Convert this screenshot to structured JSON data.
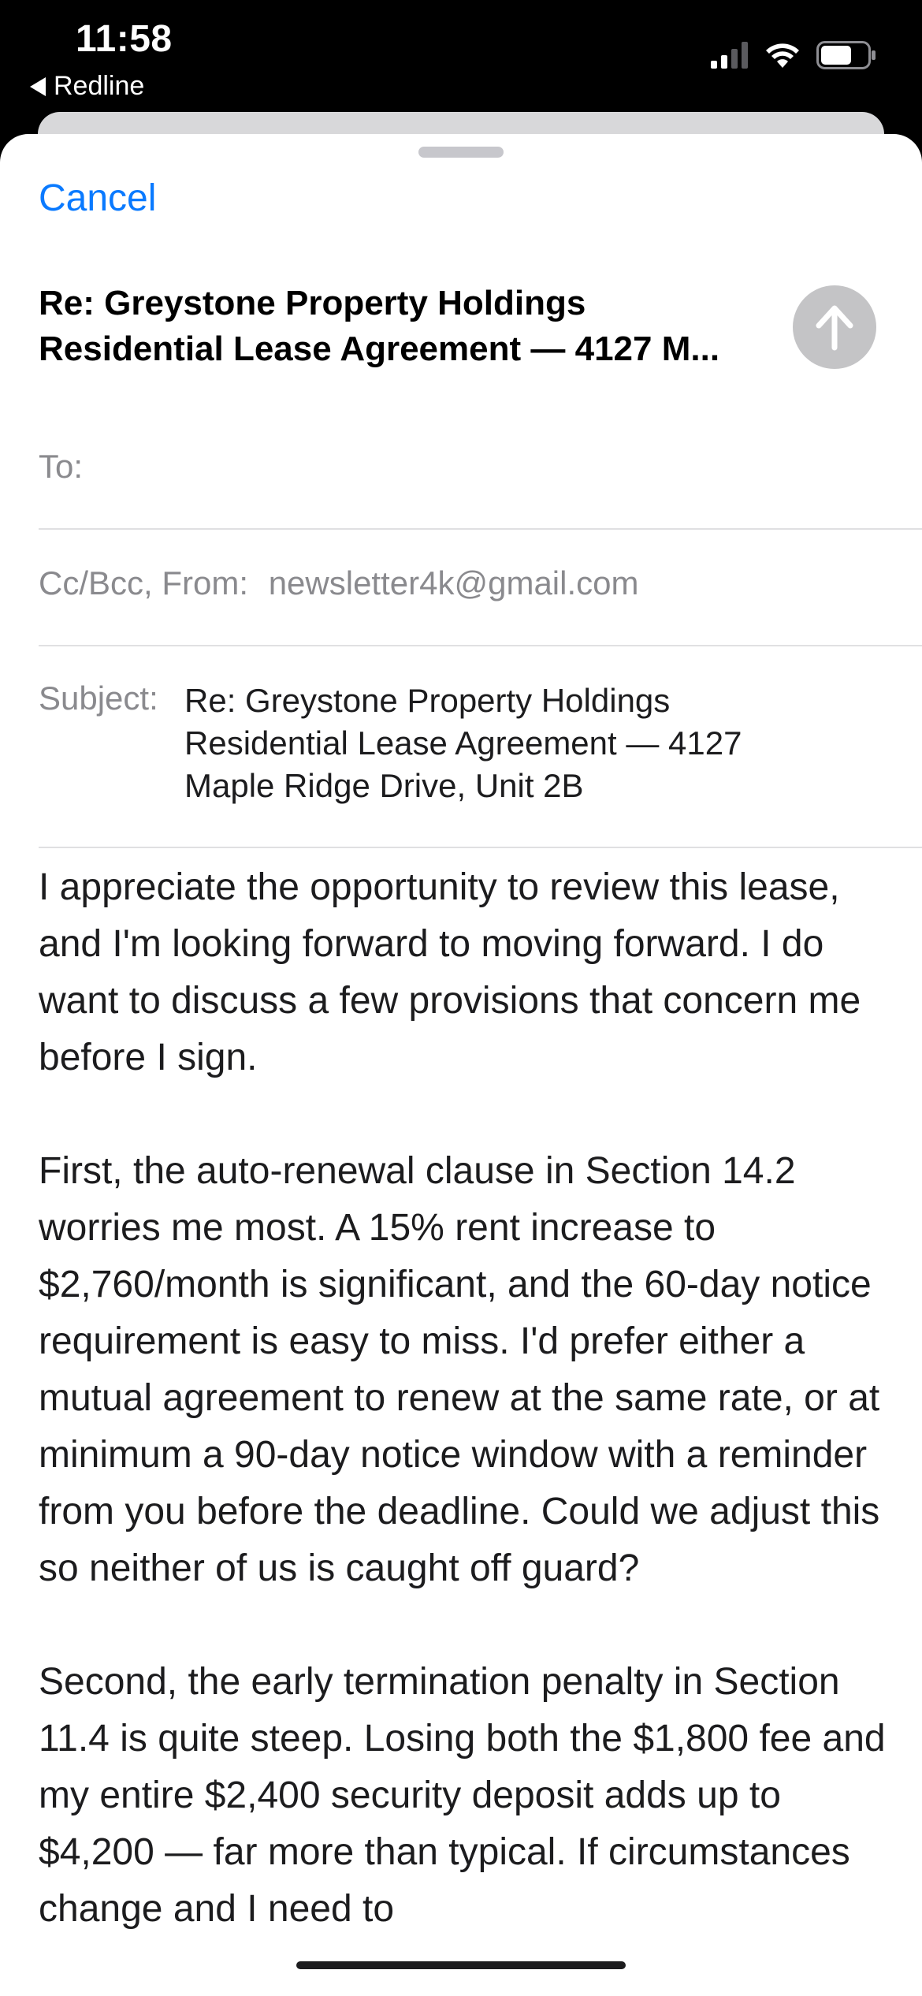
{
  "status_bar": {
    "time": "11:58",
    "back_app": "Redline"
  },
  "compose": {
    "cancel_label": "Cancel",
    "title_line1": "Re: Greystone Property Holdings",
    "title_line2": "Residential Lease Agreement — 4127 M...",
    "to_label": "To:",
    "ccbcc_label": "Cc/Bcc, From:",
    "from_value": "newsletter4k@gmail.com",
    "subject_label": "Subject:",
    "subject_value": "Re: Greystone Property Holdings Residential Lease Agreement — 4127 Maple Ridge Drive, Unit 2B"
  },
  "body": {
    "p1": "I appreciate the opportunity to review this lease, and I'm looking forward to moving forward. I do want to discuss a few provisions that concern me before I sign.",
    "p2": "First, the auto-renewal clause in Section 14.2 worries me most. A 15% rent increase to $2,760/month is significant, and the 60-day notice requirement is easy to miss. I'd prefer either a mutual agreement to renew at the same rate, or at minimum a 90-day notice window with a reminder from you before the deadline. Could we adjust this so neither of us is caught off guard?",
    "p3": "Second, the early termination penalty in Section 11.4 is quite steep. Losing both the $1,800 fee and my entire $2,400 security deposit adds up to $4,200 — far more than typical. If circumstances change and I need to"
  },
  "colors": {
    "accent": "#0a7aff",
    "send_disabled": "#c4c4c6"
  }
}
